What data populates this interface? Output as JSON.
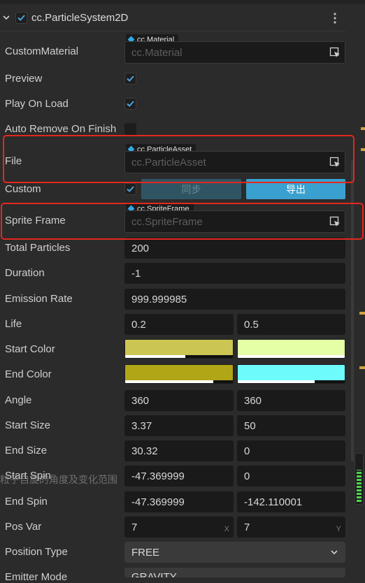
{
  "header": {
    "title": "cc.ParticleSystem2D"
  },
  "custom_material": {
    "label": "CustomMaterial",
    "tag": "cc.Material",
    "placeholder": "cc.Material"
  },
  "preview": {
    "label": "Preview"
  },
  "play_on_load": {
    "label": "Play On Load"
  },
  "auto_remove": {
    "label": "Auto Remove On Finish"
  },
  "file": {
    "label": "File",
    "tag": "cc.ParticleAsset",
    "placeholder": "cc.ParticleAsset"
  },
  "custom": {
    "label": "Custom",
    "sync_label": "同步",
    "export_label": "导出"
  },
  "sprite_frame": {
    "label": "Sprite Frame",
    "tag": "cc.SpriteFrame",
    "placeholder": "cc.SpriteFrame"
  },
  "total_particles": {
    "label": "Total Particles",
    "value": "200"
  },
  "duration": {
    "label": "Duration",
    "value": "-1"
  },
  "emission_rate": {
    "label": "Emission Rate",
    "value": "999.999985"
  },
  "life": {
    "label": "Life",
    "value": "0.2",
    "var": "0.5"
  },
  "start_color": {
    "label": "Start Color",
    "color": "#cbc653",
    "color_var": "#e4ffa6",
    "alpha": 0.56,
    "alpha_var": 1.0
  },
  "end_color": {
    "label": "End Color",
    "color": "#b0a616",
    "color_var": "#6efbfb",
    "alpha": 0.82,
    "alpha_var": 0.72
  },
  "angle": {
    "label": "Angle",
    "value": "360",
    "var": "360"
  },
  "start_size": {
    "label": "Start Size",
    "value": "3.37",
    "var": "50"
  },
  "end_size": {
    "label": "End Size",
    "value": "30.32",
    "var": "0"
  },
  "start_spin": {
    "label": "Start Spin",
    "tooltip": "粒子自旋的角度及变化范围",
    "value": "-47.369999",
    "var": "0"
  },
  "end_spin": {
    "label": "End Spin",
    "value": "-47.369999",
    "var": "-142.110001"
  },
  "pos_var": {
    "label": "Pos Var",
    "x": "7",
    "y": "7",
    "x_axis": "X",
    "y_axis": "Y"
  },
  "position_type": {
    "label": "Position Type",
    "value": "FREE"
  },
  "emitter_mode": {
    "label": "Emitter Mode",
    "value": "GRAVITY"
  }
}
